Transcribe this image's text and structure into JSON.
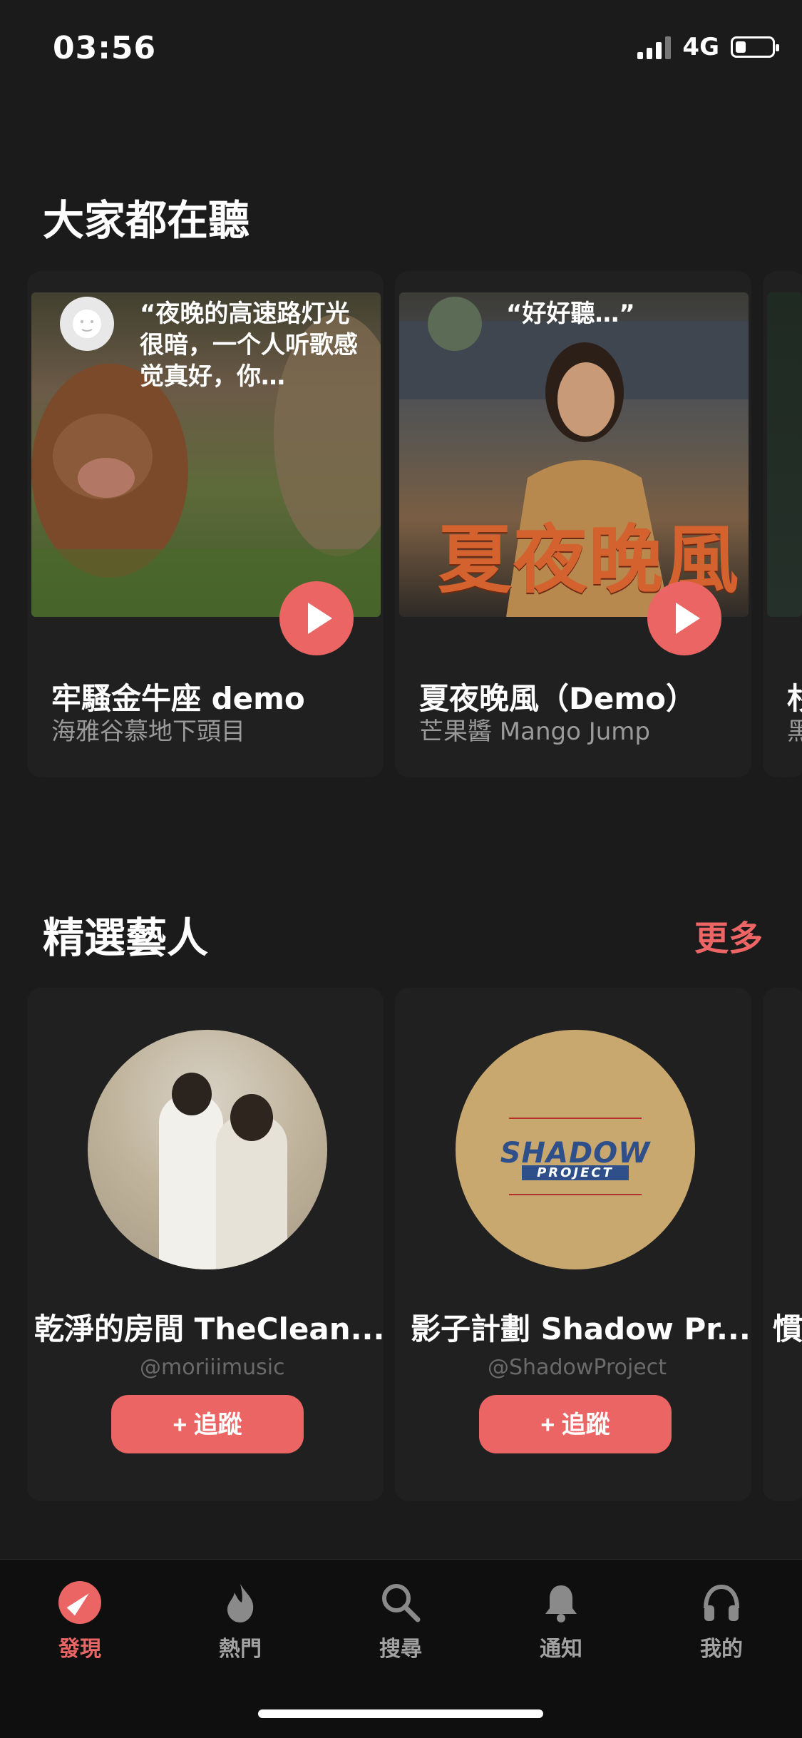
{
  "status_bar": {
    "time": "03:56",
    "network": "4G",
    "battery_level": 0.3
  },
  "section_trending": {
    "title": "大家都在聽",
    "cards": [
      {
        "quote": "“夜晚的高速路灯光很暗，一个人听歌感觉真好，你…",
        "title": "牢騷金牛座 demo",
        "artist": "海雅谷慕地下頭目"
      },
      {
        "quote": "“好好聽…”",
        "overlay": "夏夜晚風",
        "title": "夏夜晚風（Demo）",
        "artist": "芒果醬 Mango Jump"
      },
      {
        "title": "杉",
        "artist": "黑"
      }
    ]
  },
  "section_artists": {
    "title": "精選藝人",
    "more_label": "更多",
    "artists": [
      {
        "name": "乾淨的房間 TheClean...",
        "handle": "@moriiimusic",
        "follow_label": "+ 追蹤"
      },
      {
        "name": "影子計劃 Shadow Pr...",
        "handle": "@ShadowProject",
        "follow_label": "+ 追蹤",
        "logo": "SHADOW",
        "logo_sub": "PROJECT"
      },
      {
        "name": "慣"
      }
    ]
  },
  "tabbar": {
    "items": [
      {
        "label": "發現",
        "icon": "compass-icon",
        "active": true
      },
      {
        "label": "熱門",
        "icon": "flame-icon"
      },
      {
        "label": "搜尋",
        "icon": "search-icon"
      },
      {
        "label": "通知",
        "icon": "bell-icon"
      },
      {
        "label": "我的",
        "icon": "headphones-icon"
      }
    ]
  },
  "colors": {
    "accent": "#ec6565",
    "background": "#1b1b1b"
  }
}
